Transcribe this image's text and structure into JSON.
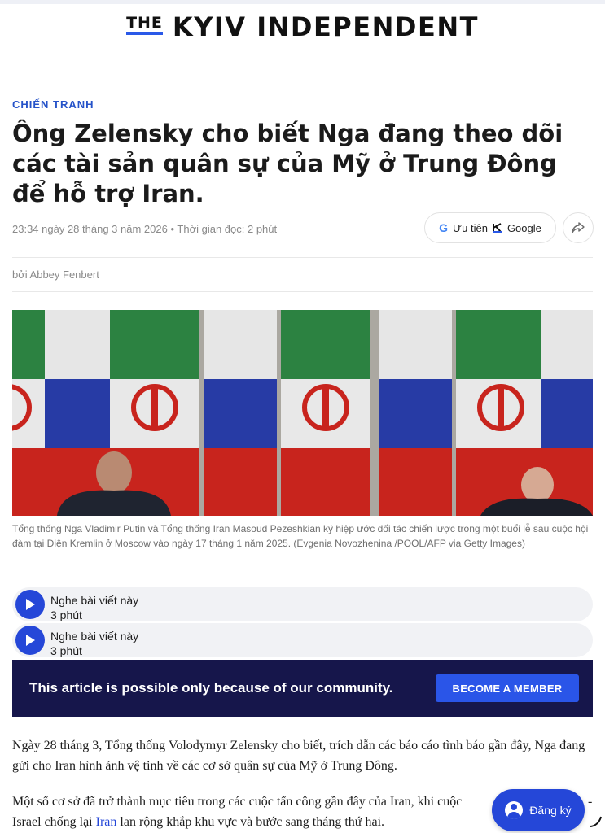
{
  "masthead": {
    "logo_the": "THE",
    "logo_main": "KYIV INDEPENDENT"
  },
  "article": {
    "section": "CHIẾN TRANH",
    "headline": "Ông Zelensky cho biết Nga đang theo dõi các tài sản quân sự của Mỹ ở Trung Đông để hỗ trợ Iran.",
    "date": "23:34 ngày 28 tháng 3 năm 2026",
    "separator": "•",
    "read_time": "Thời gian đọc: 2 phút",
    "byline": "bởi Abbey Fenbert",
    "caption": "Tổng thống Nga Vladimir Putin và Tổng thống Iran Masoud Pezeshkian ký hiệp ước đối tác chiến lược trong một buổi lễ sau cuộc hội đàm tại Điện Kremlin ở Moscow vào ngày 17 tháng 1 năm 2025. (Evgenia Novozhenina /POOL/AFP via Getty Images)",
    "paragraph1": "Ngày 28 tháng 3, Tổng thống Volodymyr Zelensky cho biết, trích dẫn các báo cáo tình báo gần đây, Nga đang gửi cho Iran hình ảnh vệ tinh về các cơ sở quân sự của Mỹ ở Trung Đông.",
    "paragraph2_line1": "Một số cơ sở đã trở thành mục tiêu trong các cuộc tấn công gần đây của Iran, khi cuộc",
    "paragraph2_tail": "-",
    "paragraph2_start": "Israel chống lại ",
    "paragraph2_link": "Iran",
    "paragraph2_end": " lan rộng khắp khu vực và bước sang tháng thứ hai."
  },
  "preference_button": {
    "g": "G",
    "label": "Ưu tiên",
    "brand": "Google"
  },
  "audio_players": [
    {
      "title": "Nghe bài viết này",
      "duration": "3 phút"
    },
    {
      "title": "Nghe bài viết này",
      "duration": "3 phút"
    }
  ],
  "banner": {
    "text": "This article is possible only because of our community.",
    "button": "BECOME A MEMBER"
  },
  "subscribe_fab": {
    "label": "Đăng ký"
  },
  "colors": {
    "accent": "#2547d8",
    "banner_bg": "#16164b",
    "section": "#2653c9"
  }
}
